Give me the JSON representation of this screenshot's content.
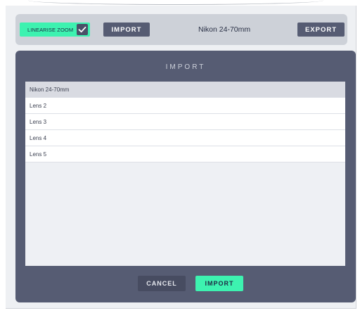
{
  "toolbar": {
    "linearise_zoom_label": "LINEARISE ZOOM",
    "linearise_zoom_checked": true,
    "import_label": "IMPORT",
    "current_lens": "Nikon 24-70mm",
    "export_label": "EXPORT"
  },
  "modal": {
    "title": "IMPORT",
    "items": [
      {
        "label": "Nikon 24-70mm",
        "selected": true
      },
      {
        "label": "Lens 2",
        "selected": false
      },
      {
        "label": "Lens 3",
        "selected": false
      },
      {
        "label": "Lens 4",
        "selected": false
      },
      {
        "label": "Lens 5",
        "selected": false
      }
    ],
    "cancel_label": "CANCEL",
    "import_label": "IMPORT"
  },
  "colors": {
    "accent": "#3df2b0",
    "dark_button": "#565c73",
    "modal_bg": "#565c73",
    "toolbar_bg": "#cdd1d8"
  }
}
